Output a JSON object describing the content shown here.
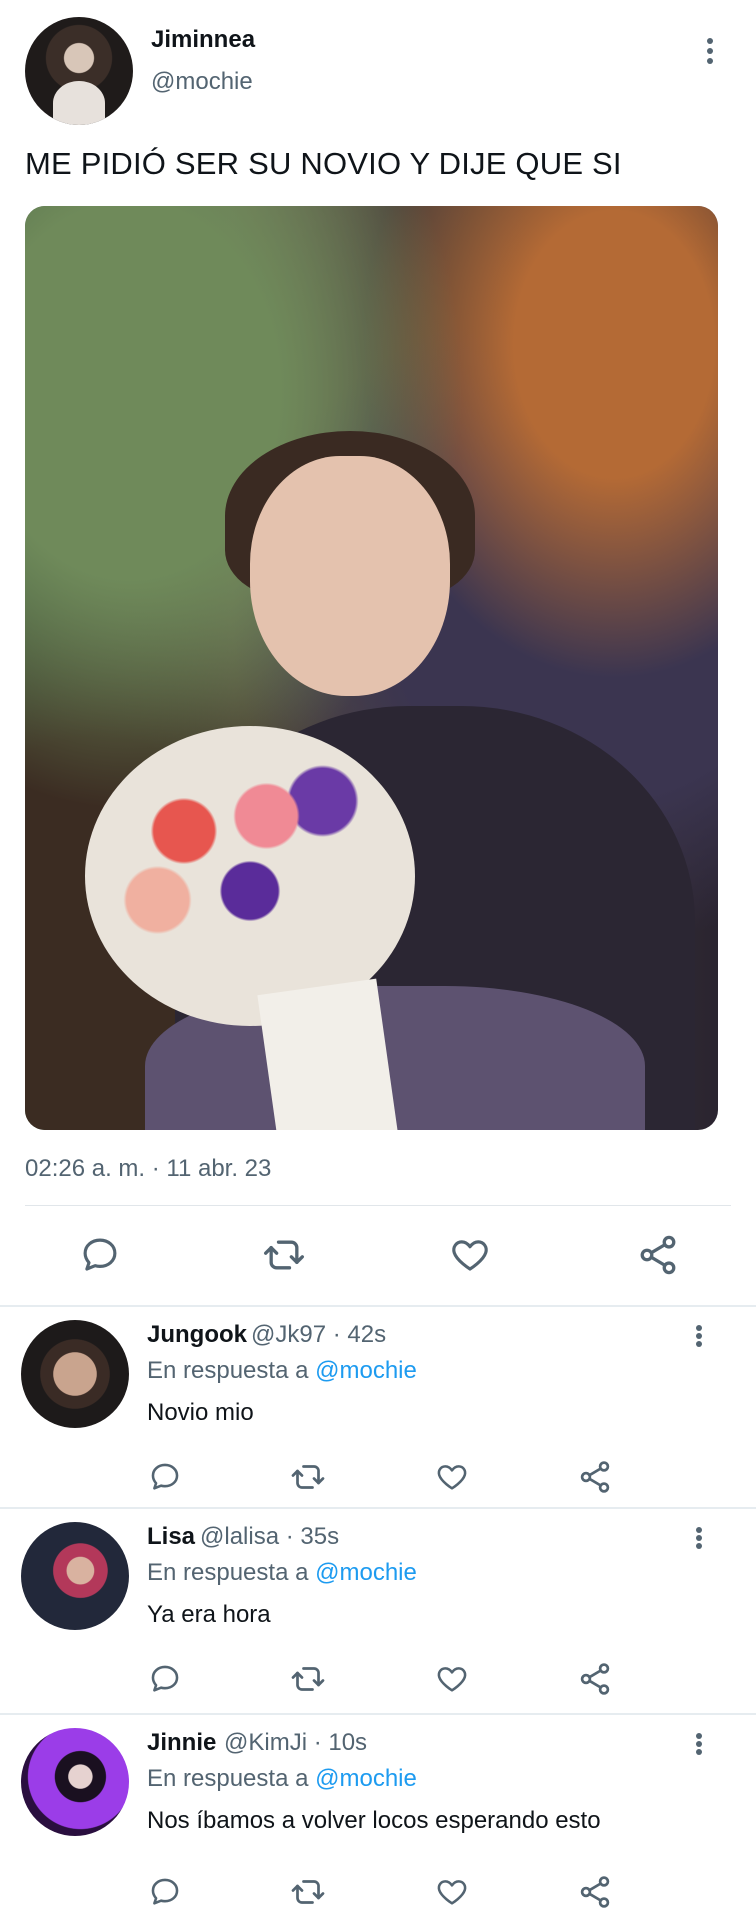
{
  "main_tweet": {
    "display_name": "Jiminnea",
    "handle": "@mochie",
    "text": "ME PIDIÓ SER SU NOVIO Y DIJE QUE SI",
    "timestamp": "02:26 a. m. · 11 abr. 23",
    "avatar_icon": "profile-photo",
    "media_icon": "photo"
  },
  "replies": [
    {
      "display_name": "Jungook",
      "meta": "@Jk97 · 42s",
      "in_reply_prefix": "En respuesta a",
      "in_reply_mention": "@mochie",
      "text": "Novio mio",
      "avatar_colors": [
        "#c9a48e",
        "#2a2222"
      ]
    },
    {
      "display_name": "Lisa",
      "meta": "@lalisa · 35s",
      "in_reply_prefix": "En respuesta a",
      "in_reply_mention": "@mochie",
      "text": "Ya era hora",
      "avatar_colors": [
        "#4aa9d8",
        "#1b1f2c"
      ]
    },
    {
      "display_name": "Jinnie",
      "meta": "@KimJi · 10s",
      "in_reply_prefix": "En respuesta a",
      "in_reply_mention": "@mochie",
      "text": "Nos íbamos a volver locos esperando esto",
      "avatar_colors": [
        "#b04dff",
        "#2a0f3f"
      ]
    }
  ],
  "icons": [
    "reply-icon",
    "retweet-icon",
    "like-icon",
    "share-icon",
    "more-icon"
  ],
  "colors": {
    "text": "#0f1419",
    "secondary": "#536471",
    "mention": "#1d9bf0",
    "divider": "#e6ecf0"
  }
}
